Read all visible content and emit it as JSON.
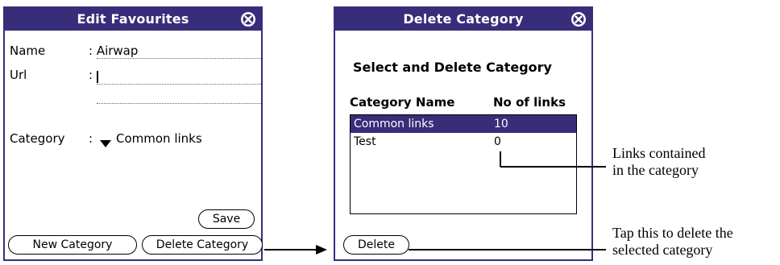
{
  "edit_screen": {
    "title": "Edit Favourites",
    "name_label": "Name",
    "name_value": ": Airwap",
    "url_label": "Url",
    "url_colon": ":",
    "category_label": "Category",
    "category_colon": ":",
    "category_value": "Common links",
    "save_label": "Save",
    "new_category_label": "New Category",
    "delete_category_label": "Delete Category"
  },
  "delete_screen": {
    "title": "Delete Category",
    "heading": "Select and Delete Category",
    "col_name": "Category Name",
    "col_count": "No of links",
    "rows": [
      {
        "name": "Common links",
        "count": "10"
      },
      {
        "name": "Test",
        "count": "0"
      }
    ],
    "selected_row": 0,
    "delete_label": "Delete"
  },
  "annotations": {
    "links_line1": "Links contained",
    "links_line2": "in the category",
    "tap_line1": "Tap this to delete the",
    "tap_line2": "selected category"
  },
  "colors": {
    "titlebar": "#372d79",
    "selection": "#372d79"
  },
  "icons": [
    "close-icon",
    "dropdown-arrow-icon",
    "arrow-right-icon"
  ]
}
